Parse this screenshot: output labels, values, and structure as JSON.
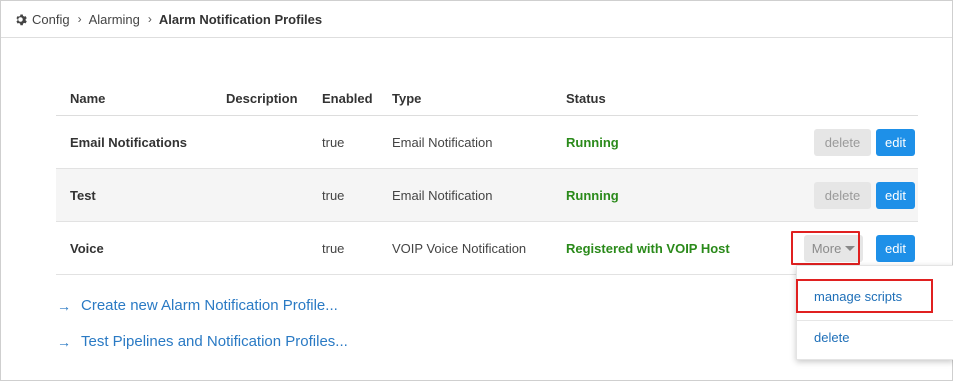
{
  "breadcrumb": {
    "icon": "gear-icon",
    "items": [
      "Config",
      "Alarming"
    ],
    "separator": "›",
    "current": "Alarm Notification Profiles"
  },
  "table": {
    "headers": {
      "name": "Name",
      "description": "Description",
      "enabled": "Enabled",
      "type": "Type",
      "status": "Status"
    },
    "rows": [
      {
        "name": "Email Notifications",
        "description": "",
        "enabled": "true",
        "type": "Email Notification",
        "status": "Running",
        "delete": "delete",
        "edit": "edit"
      },
      {
        "name": "Test",
        "description": "",
        "enabled": "true",
        "type": "Email Notification",
        "status": "Running",
        "delete": "delete",
        "edit": "edit"
      },
      {
        "name": "Voice",
        "description": "",
        "enabled": "true",
        "type": "VOIP Voice Notification",
        "status": "Registered with VOIP Host",
        "more": "More",
        "edit": "edit"
      }
    ]
  },
  "dropdown": {
    "items": [
      "manage scripts",
      "delete"
    ]
  },
  "links": [
    {
      "arrow": "→",
      "label": "Create new Alarm Notification Profile..."
    },
    {
      "arrow": "→",
      "label": "Test Pipelines and Notification Profiles..."
    }
  ],
  "colors": {
    "status_ok": "#2a8a1a",
    "edit_button": "#1e90e8",
    "link": "#2a7ac4",
    "highlight": "#e02020"
  }
}
